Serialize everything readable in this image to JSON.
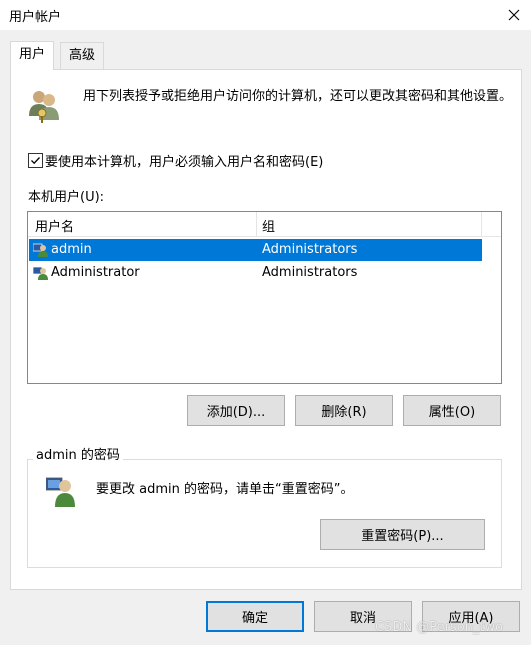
{
  "window": {
    "title": "用户帐户"
  },
  "tabs": [
    {
      "label": "用户",
      "active": true
    },
    {
      "label": "高级",
      "active": false
    }
  ],
  "description": "用下列表授予或拒绝用户访问你的计算机，还可以更改其密码和其他设置。",
  "require_login": {
    "checked": true,
    "label": "要使用本计算机，用户必须输入用户名和密码(E)"
  },
  "local_users_label": "本机用户(U):",
  "users_table": {
    "columns": [
      "用户名",
      "组"
    ],
    "rows": [
      {
        "name": "admin",
        "group": "Administrators",
        "selected": true
      },
      {
        "name": "Administrator",
        "group": "Administrators",
        "selected": false
      }
    ]
  },
  "user_buttons": {
    "add": "添加(D)...",
    "remove": "删除(R)",
    "properties": "属性(O)"
  },
  "password_group": {
    "title": "admin 的密码",
    "text": "要更改 admin 的密码，请单击“重置密码”。",
    "reset_button": "重置密码(P)..."
  },
  "dialog_buttons": {
    "ok": "确定",
    "cancel": "取消",
    "apply": "应用(A)"
  },
  "watermark": "CSDN @Person_two",
  "colors": {
    "selection": "#0078d7",
    "default_border": "#0078d7"
  }
}
